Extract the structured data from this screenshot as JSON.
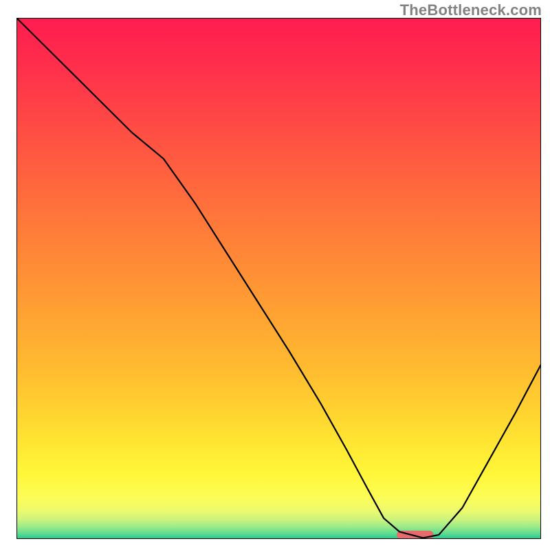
{
  "attribution": "TheBottleneck.com",
  "chart_data": {
    "type": "line",
    "title": "",
    "xlabel": "",
    "ylabel": "",
    "xlim": [
      0,
      100
    ],
    "ylim": [
      0,
      100
    ],
    "grid": false,
    "legend": false,
    "background": {
      "type": "vertical-gradient",
      "stops": [
        {
          "offset": 0.0,
          "color": "#ff1c50"
        },
        {
          "offset": 0.08,
          "color": "#ff2c4c"
        },
        {
          "offset": 0.18,
          "color": "#ff4446"
        },
        {
          "offset": 0.28,
          "color": "#ff5d40"
        },
        {
          "offset": 0.38,
          "color": "#ff753a"
        },
        {
          "offset": 0.48,
          "color": "#ff8d36"
        },
        {
          "offset": 0.58,
          "color": "#ffa532"
        },
        {
          "offset": 0.68,
          "color": "#ffbd30"
        },
        {
          "offset": 0.76,
          "color": "#ffd430"
        },
        {
          "offset": 0.82,
          "color": "#ffe733"
        },
        {
          "offset": 0.875,
          "color": "#fff638"
        },
        {
          "offset": 0.92,
          "color": "#fcfd56"
        },
        {
          "offset": 0.945,
          "color": "#edfa6d"
        },
        {
          "offset": 0.962,
          "color": "#cdf47c"
        },
        {
          "offset": 0.975,
          "color": "#a2ec88"
        },
        {
          "offset": 0.986,
          "color": "#6fe090"
        },
        {
          "offset": 0.994,
          "color": "#44d391"
        },
        {
          "offset": 1.0,
          "color": "#20c78d"
        }
      ]
    },
    "series": [
      {
        "name": "bottleneck-curve",
        "color": "#000000",
        "stroke_width": 2.2,
        "x": [
          0.0,
          5.0,
          12.0,
          22.0,
          28.0,
          34.0,
          40.0,
          46.0,
          52.0,
          58.0,
          63.0,
          67.0,
          70.0,
          73.0,
          77.5,
          80.5,
          85.0,
          90.0,
          95.0,
          100.0
        ],
        "y": [
          100.0,
          95.0,
          88.0,
          78.0,
          73.0,
          64.5,
          55.0,
          45.5,
          36.0,
          26.0,
          17.0,
          9.5,
          4.0,
          1.4,
          0.2,
          0.8,
          6.0,
          15.0,
          24.0,
          33.5
        ]
      }
    ],
    "marker": {
      "name": "optimal-range-pill",
      "color": "#e86a6b",
      "x_start": 72.5,
      "x_end": 79.5,
      "y": 0.8,
      "height_pct": 1.6
    }
  }
}
